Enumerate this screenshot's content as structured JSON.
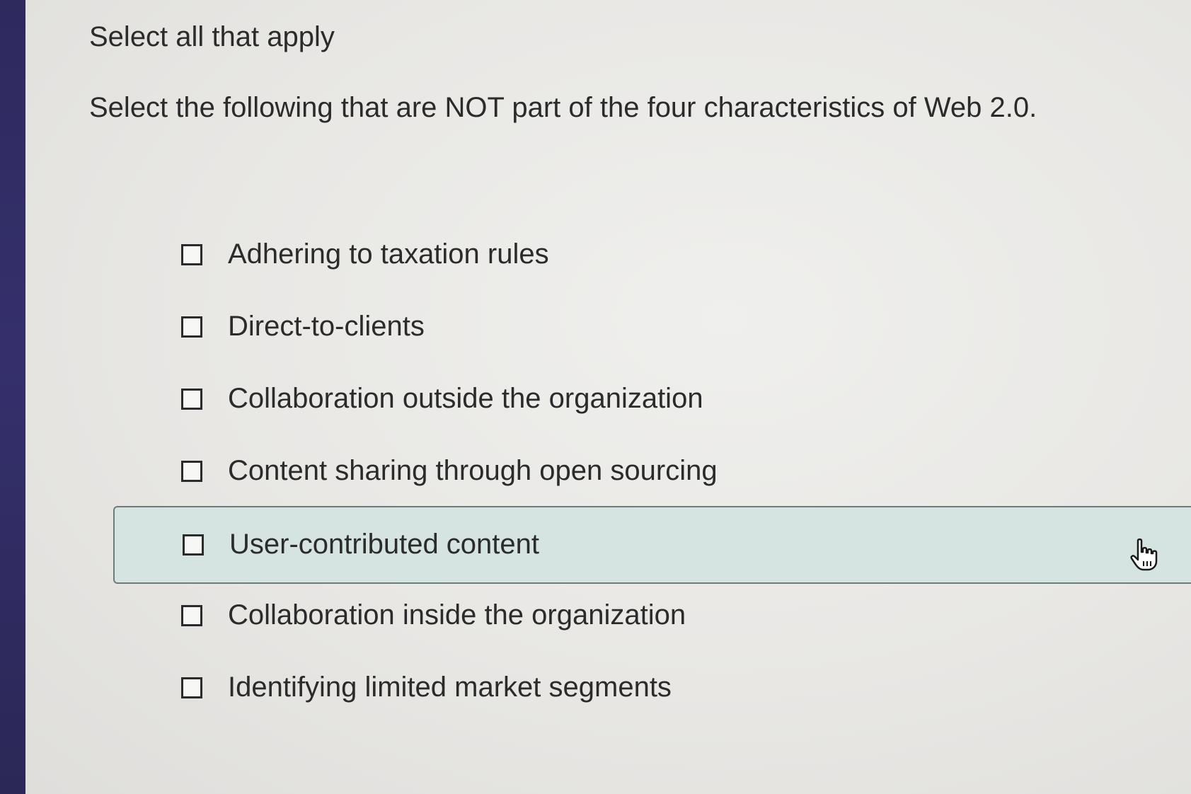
{
  "instruction": "Select all that apply",
  "question": "Select the following that are NOT part of the four characteristics of Web 2.0.",
  "options": [
    {
      "label": "Adhering to taxation rules",
      "checked": false,
      "highlighted": false
    },
    {
      "label": "Direct-to-clients",
      "checked": false,
      "highlighted": false
    },
    {
      "label": "Collaboration outside the organization",
      "checked": false,
      "highlighted": false
    },
    {
      "label": "Content sharing through open sourcing",
      "checked": false,
      "highlighted": false
    },
    {
      "label": "User-contributed content",
      "checked": false,
      "highlighted": true
    },
    {
      "label": "Collaboration inside the organization",
      "checked": false,
      "highlighted": false
    },
    {
      "label": "Identifying limited market segments",
      "checked": false,
      "highlighted": false
    }
  ],
  "colors": {
    "side_bar": "#2e2a5e",
    "highlight_fill": "#d5e4e1",
    "text": "#2b2b2b"
  },
  "cursor_icon": "hand-pointer-icon"
}
